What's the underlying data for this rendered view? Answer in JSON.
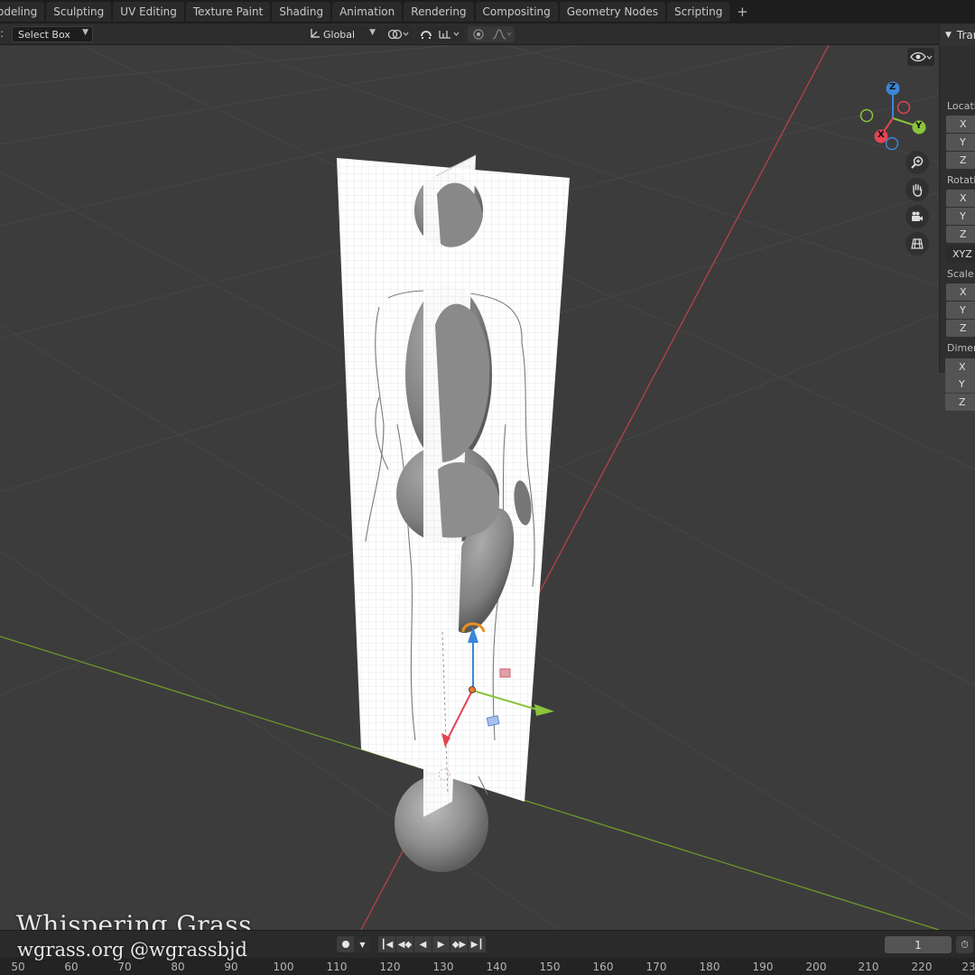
{
  "workspace_tabs": [
    "odeling",
    "Sculpting",
    "UV Editing",
    "Texture Paint",
    "Shading",
    "Animation",
    "Rendering",
    "Compositing",
    "Geometry Nodes",
    "Scripting"
  ],
  "add_tab_label": "+",
  "toolbar": {
    "colon": ":",
    "select_mode": "Select Box",
    "orientation": "Global"
  },
  "gizmo": {
    "z_label": "Z",
    "y_label": "Y",
    "x_label": "X",
    "colors": {
      "x": "#e34452",
      "y": "#8bc43d",
      "z": "#3b86d8"
    }
  },
  "nav_buttons": [
    "zoom-icon",
    "hand-pan-icon",
    "camera-icon",
    "grid-ortho-icon"
  ],
  "n_panel": {
    "header": "Tran",
    "location_label": "Locatio",
    "rotation_label": "Rotatio",
    "scale_label": "Scale:",
    "dimensions_label": "Dimen",
    "axis_x": "X",
    "axis_y": "Y",
    "axis_z": "Z",
    "rotation_mode": "XYZ E"
  },
  "timeline": {
    "current_frame": "1",
    "ruler_ticks": [
      "50",
      "60",
      "70",
      "80",
      "90",
      "100",
      "110",
      "120",
      "130",
      "140",
      "150",
      "160",
      "170",
      "180",
      "190",
      "200",
      "210",
      "220",
      "23"
    ]
  },
  "watermark": {
    "title": "Whispering Grass",
    "subtitle": "wgrass.org @wgrassbjd"
  },
  "colors": {
    "viewport_bg": "#3c3c3c",
    "x_axis": "#b4434b",
    "y_axis": "#6f9a2b",
    "active_blue": "#4772b3"
  }
}
